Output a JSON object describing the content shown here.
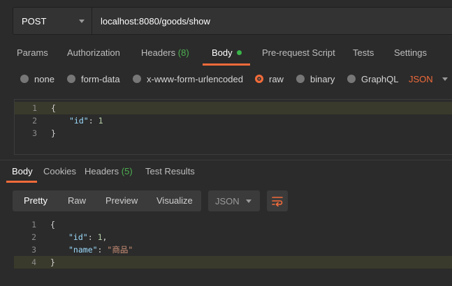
{
  "request": {
    "method": "POST",
    "url": "localhost:8080/goods/show"
  },
  "request_tabs": [
    {
      "label": "Params"
    },
    {
      "label": "Authorization"
    },
    {
      "label": "Headers",
      "count": "(8)"
    },
    {
      "label": "Body"
    },
    {
      "label": "Pre-request Script"
    },
    {
      "label": "Tests"
    },
    {
      "label": "Settings"
    }
  ],
  "body_types": [
    {
      "label": "none"
    },
    {
      "label": "form-data"
    },
    {
      "label": "x-www-form-urlencoded"
    },
    {
      "label": "raw",
      "selected": true
    },
    {
      "label": "binary"
    },
    {
      "label": "GraphQL"
    }
  ],
  "raw_format": "JSON",
  "request_body_lines": [
    {
      "num": "1",
      "text": "{"
    },
    {
      "num": "2",
      "key": "\"id\"",
      "sep": ": ",
      "value": "1"
    },
    {
      "num": "3",
      "text": "}"
    }
  ],
  "response_tabs": [
    {
      "label": "Body"
    },
    {
      "label": "Cookies"
    },
    {
      "label": "Headers",
      "count": "(5)"
    },
    {
      "label": "Test Results"
    }
  ],
  "view_modes": [
    {
      "label": "Pretty"
    },
    {
      "label": "Raw"
    },
    {
      "label": "Preview"
    },
    {
      "label": "Visualize"
    }
  ],
  "response_format": "JSON",
  "response_body_lines": [
    {
      "num": "1",
      "text": "{"
    },
    {
      "num": "2",
      "key": "\"id\"",
      "sep": ": ",
      "value": "1",
      "trail": ","
    },
    {
      "num": "3",
      "key": "\"name\"",
      "sep": ": ",
      "value": "\"商品\""
    },
    {
      "num": "4",
      "text": "}"
    }
  ],
  "colors": {
    "accent": "#f26b3a",
    "active_dot": "#3ab54a",
    "count": "#4caf50",
    "background": "#2b2b2b"
  },
  "icons": [
    "chevron-down-icon",
    "active-dot-icon",
    "wrap-lines-icon"
  ]
}
